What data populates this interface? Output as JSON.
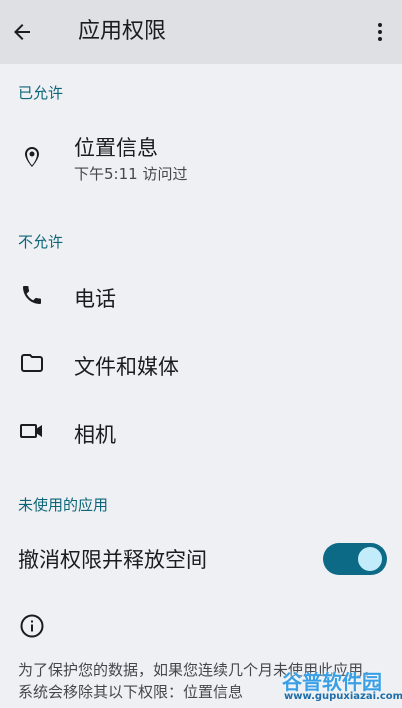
{
  "appbar": {
    "title": "应用权限",
    "back_icon": "arrow-back-icon",
    "menu_icon": "more-vert-icon"
  },
  "sections": {
    "allowed": "已允许",
    "denied": "不允许",
    "unused": "未使用的应用"
  },
  "allowed_items": [
    {
      "label": "位置信息",
      "sub": "下午5:11 访问过",
      "icon": "location-pin-icon"
    }
  ],
  "denied_items": [
    {
      "label": "电话",
      "icon": "phone-icon"
    },
    {
      "label": "文件和媒体",
      "icon": "folder-icon"
    },
    {
      "label": "相机",
      "icon": "videocam-icon"
    }
  ],
  "unused": {
    "toggle_label": "撤消权限并释放空间",
    "toggle_on": true
  },
  "info": {
    "icon": "info-icon",
    "text": "为了保护您的数据，如果您连续几个月未使用此应用，系统会移除其以下权限：位置信息"
  },
  "watermark": {
    "main": "谷普软件园",
    "sub": "www.gupuxiazai.com"
  },
  "colors": {
    "background": "#eef0f4",
    "appbar": "#dee0e4",
    "accent": "#0d6577",
    "switch_track": "#0d6a86",
    "switch_thumb": "#c3ecfb"
  }
}
